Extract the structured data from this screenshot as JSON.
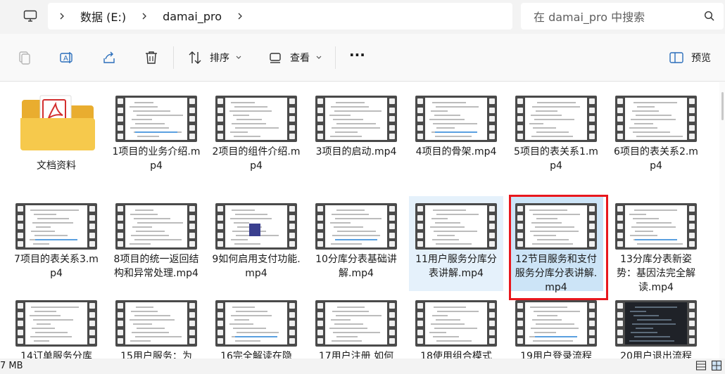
{
  "address": {
    "crumbs": [
      "数据 (E:)",
      "damai_pro"
    ],
    "search_placeholder": "在 damai_pro 中搜索"
  },
  "toolbar": {
    "sort_label": "排序",
    "view_label": "查看",
    "more_label": "···",
    "preview_label": "预览"
  },
  "files": [
    {
      "name": "文档资料",
      "type": "folder"
    },
    {
      "name": "1项目的业务介绍.mp4",
      "type": "video"
    },
    {
      "name": "2项目的组件介绍.mp4",
      "type": "video"
    },
    {
      "name": "3项目的启动.mp4",
      "type": "video"
    },
    {
      "name": "4项目的骨架.mp4",
      "type": "video"
    },
    {
      "name": "5项目的表关系1.mp4",
      "type": "video"
    },
    {
      "name": "6项目的表关系2.mp4",
      "type": "video"
    },
    {
      "name": "7项目的表关系3.mp4",
      "type": "video"
    },
    {
      "name": "8项目的统一返回结构和异常处理.mp4",
      "type": "video"
    },
    {
      "name": "9如何启用支付功能.mp4",
      "type": "video"
    },
    {
      "name": "10分库分表基础讲解.mp4",
      "type": "video"
    },
    {
      "name": "11用户服务分库分表讲解.mp4",
      "type": "video",
      "state": "hover"
    },
    {
      "name": "12节目服务和支付服务分库分表讲解.mp4",
      "type": "video",
      "state": "selected"
    },
    {
      "name": "13分库分表新姿势：基因法完全解读.mp4",
      "type": "video"
    },
    {
      "name": "14订单服务分库",
      "type": "video"
    },
    {
      "name": "15用户服务：为",
      "type": "video"
    },
    {
      "name": "16完全解读在隐",
      "type": "video"
    },
    {
      "name": "17用户注册 如何",
      "type": "video"
    },
    {
      "name": "18使用组合模式",
      "type": "video"
    },
    {
      "name": "19用户登录流程",
      "type": "video"
    },
    {
      "name": "20用户退出流程",
      "type": "video",
      "dark": true
    }
  ],
  "status": {
    "size_text": "7 MB"
  },
  "colors": {
    "selection": "#cce4f7",
    "hover": "#e5f1fb",
    "highlight_border": "#e8171d",
    "folder": "#f4c542"
  }
}
